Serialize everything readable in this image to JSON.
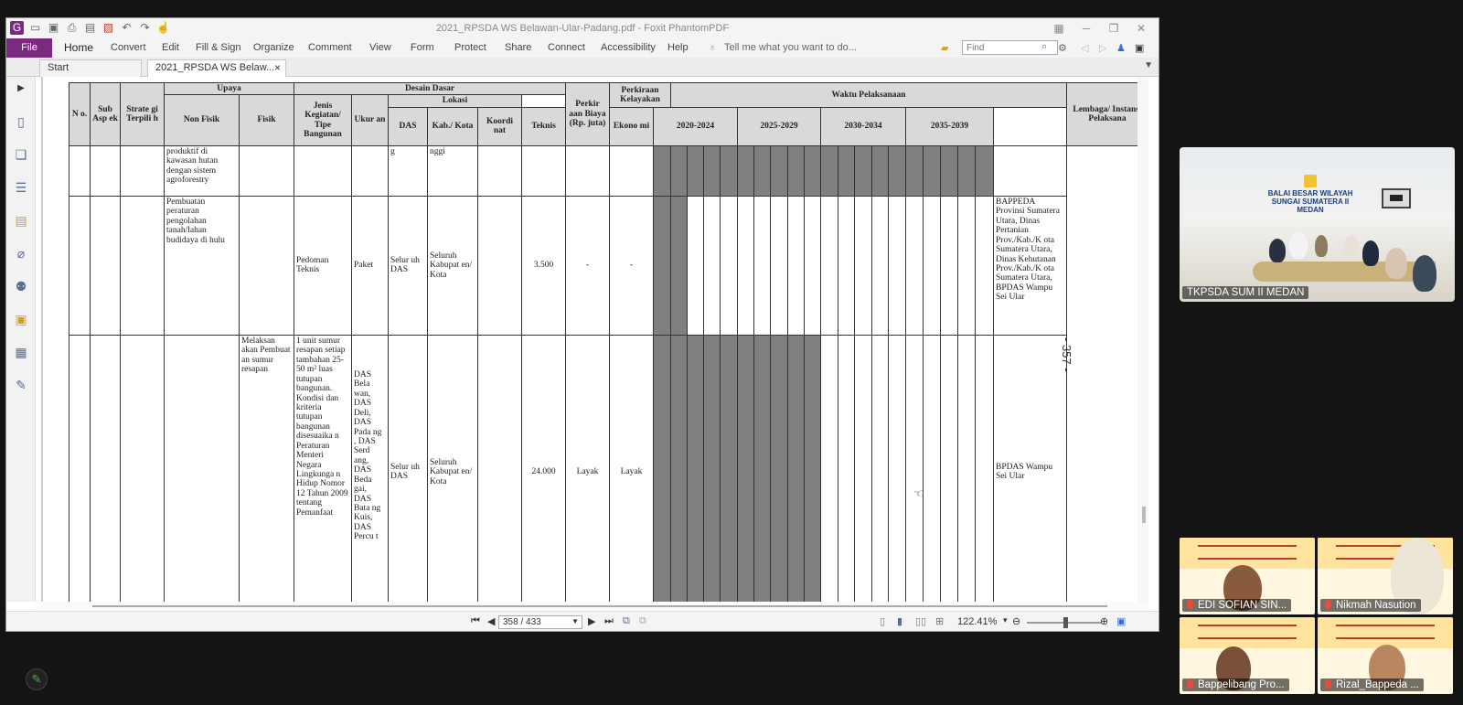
{
  "window": {
    "title": "2021_RPSDA WS Belawan-Ular-Padang.pdf - Foxit PhantomPDF"
  },
  "menu": {
    "file": "File",
    "items": [
      "Home",
      "Convert",
      "Edit",
      "Fill & Sign",
      "Organize",
      "Comment",
      "View",
      "Form",
      "Protect",
      "Share",
      "Connect",
      "Accessibility",
      "Help"
    ],
    "tell_me": "Tell me what you want to do...",
    "find_placeholder": "Find"
  },
  "tabs": {
    "start": "Start",
    "doc": "2021_RPSDA WS Belaw...",
    "close": "×"
  },
  "table": {
    "headers": {
      "no": "N o.",
      "sub_aspek": "Sub Asp ek",
      "strategi": "Strate gi Terpili h",
      "upaya": "Upaya",
      "non_fisik": "Non Fisik",
      "fisik": "Fisik",
      "desain_dasar": "Desain Dasar",
      "jenis": "Jenis Kegiatan/ Tipe Bangunan",
      "ukuran": "Ukur an",
      "lokasi": "Lokasi",
      "das": "DAS",
      "kab": "Kab./ Kota",
      "koordinat": "Koordi nat",
      "biaya": "Perkir aan Biaya (Rp. juta)",
      "kelayakan": "Perkiraan Kelayakan",
      "teknis": "Teknis",
      "ekonomi": "Ekono mi",
      "waktu": "Waktu Pelaksanaan",
      "p1": "2020-2024",
      "p2": "2025-2029",
      "p3": "2030-2034",
      "p4": "2035-2039",
      "lembaga": "Lembaga/ Instansi Pelaksana"
    },
    "rows": [
      {
        "non_fisik": "produktif di kawasan hutan dengan sistem agroforestry",
        "das": "g",
        "kab": "nggi"
      },
      {
        "non_fisik": "Pembuatan peraturan pengolahan tanah/lahan budidaya di hulu",
        "jenis": "Pedoman Teknis",
        "ukuran": "Paket",
        "das": "Selur uh DAS",
        "kab": "Seluruh Kabupat en/ Kota",
        "biaya": "3.500",
        "teknis": "-",
        "ekonomi": "-",
        "lembaga": "BAPPEDA Provinsi Sumatera Utara, Dinas Pertanian Prov./Kab./K ota Sumatera Utara, Dinas Kehutanan Prov./Kab./K ota Sumatera Utara, BPDAS Wampu Sei Ular"
      },
      {
        "fisik": "Melaksan akan Pembuat an sumur resapan",
        "jenis": "1 unit sumur resapan setiap tambahan 25-50 m² luas tutupan bangunan. Kondisi dan kriteria tutupan bangunan disesuaika n Peraturan Menteri Negara Lingkunga n Hidup Nomor 12 Tahun 2009 tentang Pemanfaat",
        "ukuran": "DAS Bela wan, DAS Deli, DAS Pada ng , DAS Serd ang, DAS Beda gai, DAS Bata ng Kuis, DAS Percu t",
        "das": "Selur uh DAS",
        "kab": "Seluruh Kabupat en/ Kota",
        "biaya": "24.000",
        "teknis": "Layak",
        "ekonomi": "Layak",
        "lembaga": "BPDAS Wampu Sei Ular"
      }
    ]
  },
  "page_label": "- 357 -",
  "status": {
    "page": "358 / 433",
    "zoom": "122.41%"
  },
  "participants": [
    {
      "name": "TKPSDA SUM II MEDAN"
    },
    {
      "name": "EDI SOFIAN SIN..."
    },
    {
      "name": "Nikmah Nasution"
    },
    {
      "name": "Bappelibang Pro..."
    },
    {
      "name": "Rizal_Bappeda ..."
    }
  ],
  "room_sign": "BALAI BESAR WILAYAH SUNGAI SUMATERA II MEDAN",
  "colors": {
    "file_tab": "#7a2b7f",
    "schedule_fill": "#808080",
    "header_fill": "#d9d9d9"
  }
}
